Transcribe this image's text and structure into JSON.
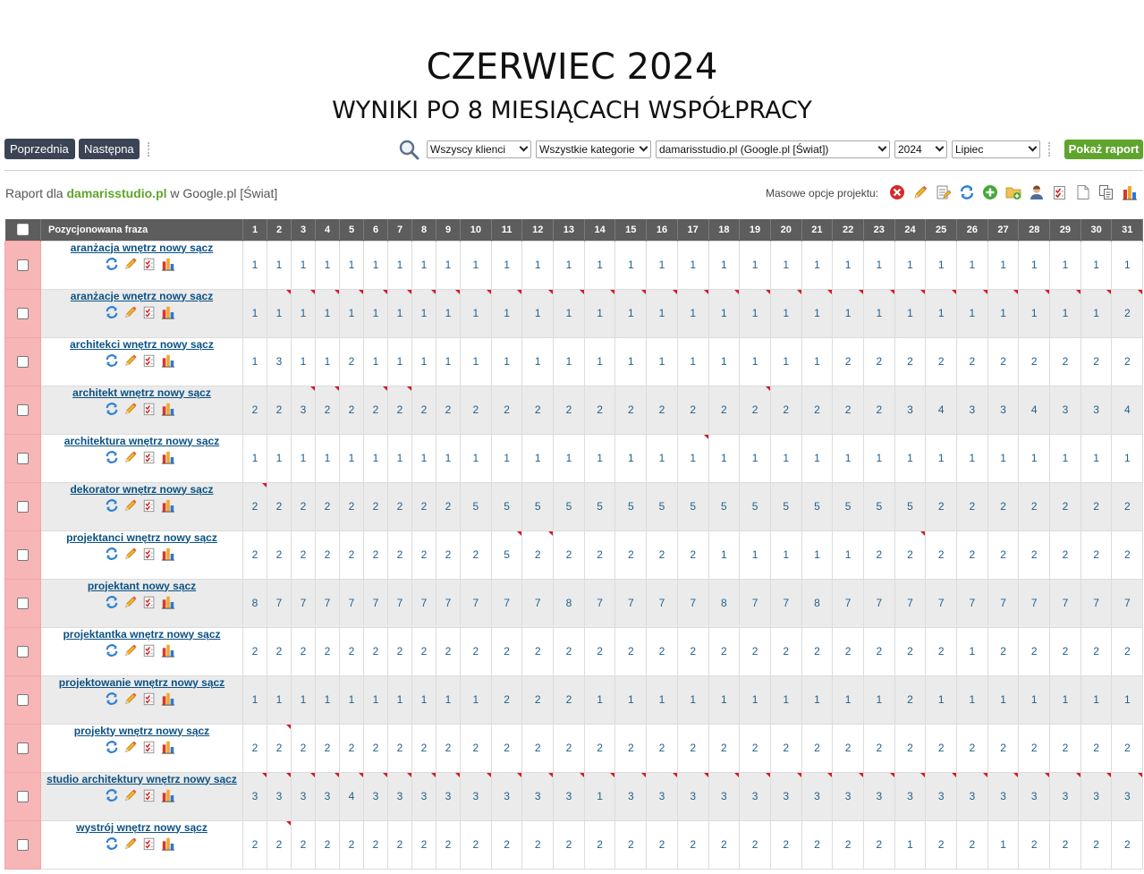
{
  "title": "CZERWIEC 2024",
  "subtitle": "WYNIKI PO 8 MIESIĄCACH WSPÓŁPRACY",
  "nav": {
    "prev_label": "Poprzednia",
    "next_label": "Następna"
  },
  "filters": {
    "client": "Wszyscy klienci",
    "category": "Wszystkie kategorie",
    "project": "damarisstudio.pl (Google.pl [Świat])",
    "year": "2024",
    "month": "Lipiec",
    "show_report_label": "Pokaż raport"
  },
  "report": {
    "prefix": "Raport dla",
    "project": "damarisstudio.pl",
    "suffix": "w Google.pl [Świat]"
  },
  "mass_options_label": "Masowe opcje projektu:",
  "mass_icons": [
    "delete-icon",
    "edit-icon",
    "edit-list-icon",
    "refresh-icon",
    "add-icon",
    "folder-add-icon",
    "user-icon",
    "checklist-icon",
    "document-icon",
    "copy-icon",
    "chart-icon"
  ],
  "table": {
    "phrase_header": "Pozycjonowana fraza",
    "days": [
      "1",
      "2",
      "3",
      "4",
      "5",
      "6",
      "7",
      "8",
      "9",
      "10",
      "11",
      "12",
      "13",
      "14",
      "15",
      "16",
      "17",
      "18",
      "19",
      "20",
      "21",
      "22",
      "23",
      "24",
      "25",
      "26",
      "27",
      "28",
      "29",
      "30",
      "31"
    ],
    "rows": [
      {
        "phrase": "aranżacja wnętrz nowy sącz",
        "values": [
          "1",
          "1",
          "1",
          "1",
          "1",
          "1",
          "1",
          "1",
          "1",
          "1",
          "1",
          "1",
          "1",
          "1",
          "1",
          "1",
          "1",
          "1",
          "1",
          "1",
          "1",
          "1",
          "1",
          "1",
          "1",
          "1",
          "1",
          "1",
          "1",
          "1",
          "1"
        ]
      },
      {
        "phrase": "aranżacje wnętrz nowy sącz",
        "values": [
          "1",
          "1",
          "1",
          "1",
          "1",
          "1",
          "1",
          "1",
          "1",
          "1",
          "1",
          "1",
          "1",
          "1",
          "1",
          "1",
          "1",
          "1",
          "1",
          "1",
          "1",
          "1",
          "1",
          "1",
          "1",
          "1",
          "1",
          "1",
          "1",
          "1",
          "2"
        ]
      },
      {
        "phrase": "architekci wnętrz nowy sącz",
        "values": [
          "1",
          "3",
          "1",
          "1",
          "2",
          "1",
          "1",
          "1",
          "1",
          "1",
          "1",
          "1",
          "1",
          "1",
          "1",
          "1",
          "1",
          "1",
          "1",
          "1",
          "1",
          "2",
          "2",
          "2",
          "2",
          "2",
          "2",
          "2",
          "2",
          "2",
          "2"
        ]
      },
      {
        "phrase": "architekt wnętrz nowy sącz",
        "values": [
          "2",
          "2",
          "3",
          "2",
          "2",
          "2",
          "2",
          "2",
          "2",
          "2",
          "2",
          "2",
          "2",
          "2",
          "2",
          "2",
          "2",
          "2",
          "2",
          "2",
          "2",
          "2",
          "2",
          "3",
          "4",
          "3",
          "3",
          "4",
          "3",
          "3",
          "4"
        ]
      },
      {
        "phrase": "architektura wnętrz nowy sącz",
        "values": [
          "1",
          "1",
          "1",
          "1",
          "1",
          "1",
          "1",
          "1",
          "1",
          "1",
          "1",
          "1",
          "1",
          "1",
          "1",
          "1",
          "1",
          "1",
          "1",
          "1",
          "1",
          "1",
          "1",
          "1",
          "1",
          "1",
          "1",
          "1",
          "1",
          "1",
          "1"
        ]
      },
      {
        "phrase": "dekorator wnętrz nowy sącz",
        "values": [
          "2",
          "2",
          "2",
          "2",
          "2",
          "2",
          "2",
          "2",
          "2",
          "5",
          "5",
          "5",
          "5",
          "5",
          "5",
          "5",
          "5",
          "5",
          "5",
          "5",
          "5",
          "5",
          "5",
          "5",
          "2",
          "2",
          "2",
          "2",
          "2",
          "2",
          "2"
        ]
      },
      {
        "phrase": "projektanci wnętrz nowy sącz",
        "values": [
          "2",
          "2",
          "2",
          "2",
          "2",
          "2",
          "2",
          "2",
          "2",
          "2",
          "5",
          "2",
          "2",
          "2",
          "2",
          "2",
          "2",
          "1",
          "1",
          "1",
          "1",
          "1",
          "2",
          "2",
          "2",
          "2",
          "2",
          "2",
          "2",
          "2",
          "2"
        ]
      },
      {
        "phrase": "projektant nowy sącz",
        "values": [
          "8",
          "7",
          "7",
          "7",
          "7",
          "7",
          "7",
          "7",
          "7",
          "7",
          "7",
          "7",
          "8",
          "7",
          "7",
          "7",
          "7",
          "8",
          "7",
          "7",
          "8",
          "7",
          "7",
          "7",
          "7",
          "7",
          "7",
          "7",
          "7",
          "7",
          "7"
        ]
      },
      {
        "phrase": "projektantka wnętrz nowy sącz",
        "values": [
          "2",
          "2",
          "2",
          "2",
          "2",
          "2",
          "2",
          "2",
          "2",
          "2",
          "2",
          "2",
          "2",
          "2",
          "2",
          "2",
          "2",
          "2",
          "2",
          "2",
          "2",
          "2",
          "2",
          "2",
          "2",
          "1",
          "2",
          "2",
          "2",
          "2",
          "2"
        ]
      },
      {
        "phrase": "projektowanie wnętrz nowy sącz",
        "values": [
          "1",
          "1",
          "1",
          "1",
          "1",
          "1",
          "1",
          "1",
          "1",
          "1",
          "2",
          "2",
          "2",
          "1",
          "1",
          "1",
          "1",
          "1",
          "1",
          "1",
          "1",
          "1",
          "1",
          "2",
          "1",
          "1",
          "1",
          "1",
          "1",
          "1",
          "1"
        ]
      },
      {
        "phrase": "projekty wnętrz nowy sącz",
        "values": [
          "2",
          "2",
          "2",
          "2",
          "2",
          "2",
          "2",
          "2",
          "2",
          "2",
          "2",
          "2",
          "2",
          "2",
          "2",
          "2",
          "2",
          "2",
          "2",
          "2",
          "2",
          "2",
          "2",
          "2",
          "2",
          "2",
          "2",
          "2",
          "2",
          "2",
          "2"
        ]
      },
      {
        "phrase": "studio architektury wnętrz nowy sącz",
        "values": [
          "3",
          "3",
          "3",
          "3",
          "4",
          "3",
          "3",
          "3",
          "3",
          "3",
          "3",
          "3",
          "3",
          "1",
          "3",
          "3",
          "3",
          "3",
          "3",
          "3",
          "3",
          "3",
          "3",
          "3",
          "3",
          "3",
          "3",
          "3",
          "3",
          "3",
          "3"
        ]
      },
      {
        "phrase": "wystrój wnętrz nowy sącz",
        "values": [
          "2",
          "2",
          "2",
          "2",
          "2",
          "2",
          "2",
          "2",
          "2",
          "2",
          "2",
          "2",
          "2",
          "2",
          "2",
          "2",
          "2",
          "2",
          "2",
          "2",
          "2",
          "2",
          "2",
          "1",
          "2",
          "2",
          "1",
          "2",
          "2",
          "2",
          "2"
        ]
      }
    ]
  }
}
